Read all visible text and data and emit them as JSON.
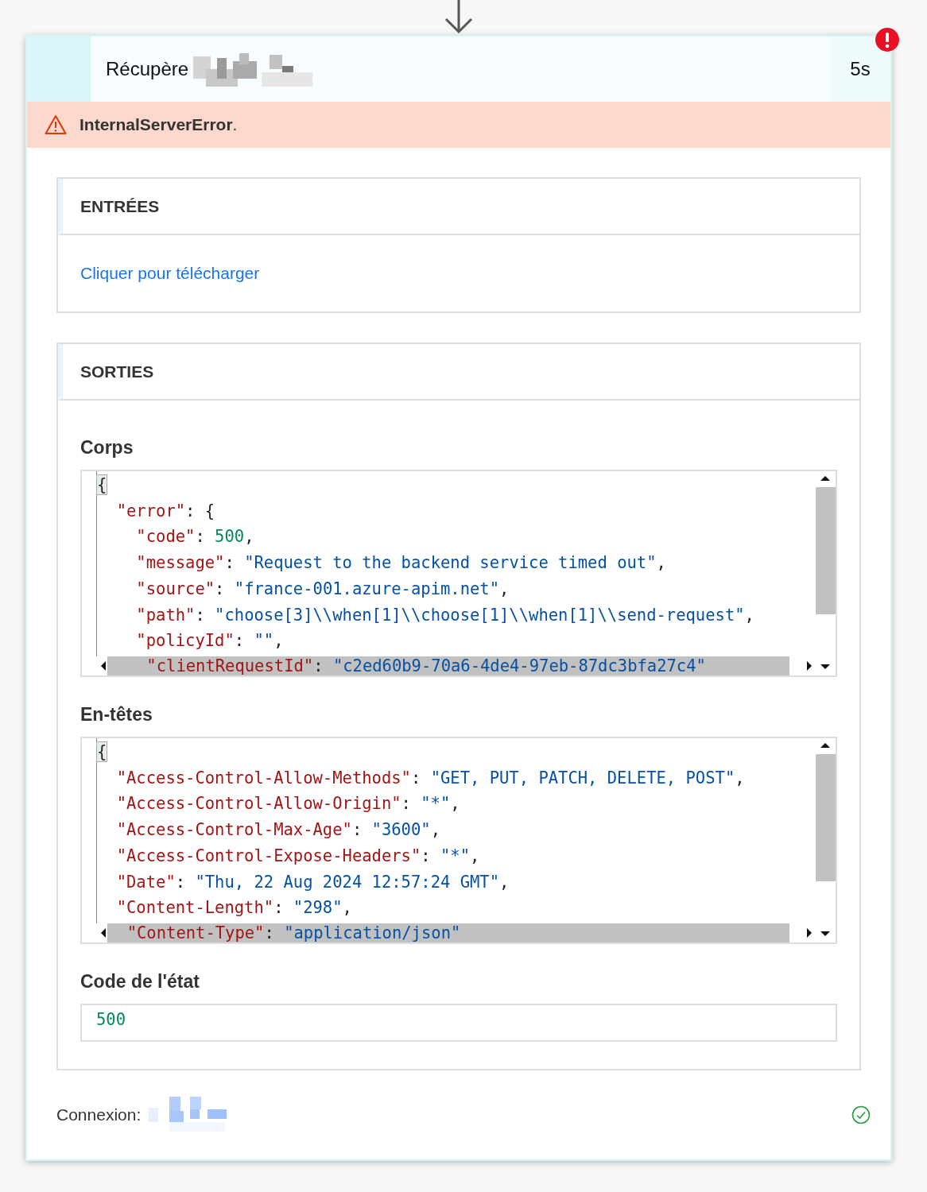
{
  "action": {
    "title": "Récupère",
    "duration": "5s",
    "failed": true
  },
  "error_banner": {
    "text": "InternalServerError",
    "suffix": "."
  },
  "inputs": {
    "heading": "ENTRÉES",
    "link": "Cliquer pour télécharger"
  },
  "outputs": {
    "heading": "SORTIES",
    "body": {
      "label": "Corps",
      "lines": [
        {
          "tokens": [
            {
              "kind": "bracket",
              "text": "{"
            }
          ],
          "children": [
            {
              "tokens": [
                {
                  "kind": "key",
                  "text": "\"error\""
                },
                {
                  "kind": "punct",
                  "text": ": {"
                }
              ],
              "children": [
                {
                  "tokens": [
                    {
                      "kind": "key",
                      "text": "\"code\""
                    },
                    {
                      "kind": "punct",
                      "text": ": "
                    },
                    {
                      "kind": "number",
                      "text": "500"
                    },
                    {
                      "kind": "punct",
                      "text": ","
                    }
                  ]
                },
                {
                  "tokens": [
                    {
                      "kind": "key",
                      "text": "\"message\""
                    },
                    {
                      "kind": "punct",
                      "text": ": "
                    },
                    {
                      "kind": "string",
                      "text": "\"Request to the backend service timed out\""
                    },
                    {
                      "kind": "punct",
                      "text": ","
                    }
                  ]
                },
                {
                  "tokens": [
                    {
                      "kind": "key",
                      "text": "\"source\""
                    },
                    {
                      "kind": "punct",
                      "text": ": "
                    },
                    {
                      "kind": "string",
                      "text": "\"france-001.azure-apim.net\""
                    },
                    {
                      "kind": "punct",
                      "text": ","
                    }
                  ]
                },
                {
                  "tokens": [
                    {
                      "kind": "key",
                      "text": "\"path\""
                    },
                    {
                      "kind": "punct",
                      "text": ": "
                    },
                    {
                      "kind": "string",
                      "text": "\"choose[3]\\\\when[1]\\\\choose[1]\\\\when[1]\\\\send-request\""
                    },
                    {
                      "kind": "punct",
                      "text": ","
                    }
                  ]
                },
                {
                  "tokens": [
                    {
                      "kind": "key",
                      "text": "\"policyId\""
                    },
                    {
                      "kind": "punct",
                      "text": ": "
                    },
                    {
                      "kind": "string",
                      "text": "\"\""
                    },
                    {
                      "kind": "punct",
                      "text": ","
                    }
                  ]
                },
                {
                  "tokens": [
                    {
                      "kind": "key",
                      "text": "\"clientRequestId\""
                    },
                    {
                      "kind": "punct",
                      "text": ": "
                    },
                    {
                      "kind": "string",
                      "text": "\"c2ed60b9-70a6-4de4-97eb-87dc3bfa27c4\""
                    }
                  ]
                }
              ]
            }
          ]
        }
      ]
    },
    "headers": {
      "label": "En-têtes",
      "lines": [
        {
          "tokens": [
            {
              "kind": "bracket",
              "text": "{"
            }
          ],
          "children": [
            {
              "tokens": [
                {
                  "kind": "key",
                  "text": "\"Access-Control-Allow-Methods\""
                },
                {
                  "kind": "punct",
                  "text": ": "
                },
                {
                  "kind": "string",
                  "text": "\"GET, PUT, PATCH, DELETE, POST\""
                },
                {
                  "kind": "punct",
                  "text": ","
                }
              ]
            },
            {
              "tokens": [
                {
                  "kind": "key",
                  "text": "\"Access-Control-Allow-Origin\""
                },
                {
                  "kind": "punct",
                  "text": ": "
                },
                {
                  "kind": "string",
                  "text": "\"*\""
                },
                {
                  "kind": "punct",
                  "text": ","
                }
              ]
            },
            {
              "tokens": [
                {
                  "kind": "key",
                  "text": "\"Access-Control-Max-Age\""
                },
                {
                  "kind": "punct",
                  "text": ": "
                },
                {
                  "kind": "string",
                  "text": "\"3600\""
                },
                {
                  "kind": "punct",
                  "text": ","
                }
              ]
            },
            {
              "tokens": [
                {
                  "kind": "key",
                  "text": "\"Access-Control-Expose-Headers\""
                },
                {
                  "kind": "punct",
                  "text": ": "
                },
                {
                  "kind": "string",
                  "text": "\"*\""
                },
                {
                  "kind": "punct",
                  "text": ","
                }
              ]
            },
            {
              "tokens": [
                {
                  "kind": "key",
                  "text": "\"Date\""
                },
                {
                  "kind": "punct",
                  "text": ": "
                },
                {
                  "kind": "string",
                  "text": "\"Thu, 22 Aug 2024 12:57:24 GMT\""
                },
                {
                  "kind": "punct",
                  "text": ","
                }
              ]
            },
            {
              "tokens": [
                {
                  "kind": "key",
                  "text": "\"Content-Length\""
                },
                {
                  "kind": "punct",
                  "text": ": "
                },
                {
                  "kind": "string",
                  "text": "\"298\""
                },
                {
                  "kind": "punct",
                  "text": ","
                }
              ]
            },
            {
              "tokens": [
                {
                  "kind": "key",
                  "text": "\"Content-Type\""
                },
                {
                  "kind": "punct",
                  "text": ": "
                },
                {
                  "kind": "string",
                  "text": "\"application/json\""
                }
              ]
            }
          ]
        }
      ]
    },
    "status_code": {
      "label": "Code de l'état",
      "value": "500"
    }
  },
  "connection": {
    "label": "Connexion:",
    "connected": true
  }
}
